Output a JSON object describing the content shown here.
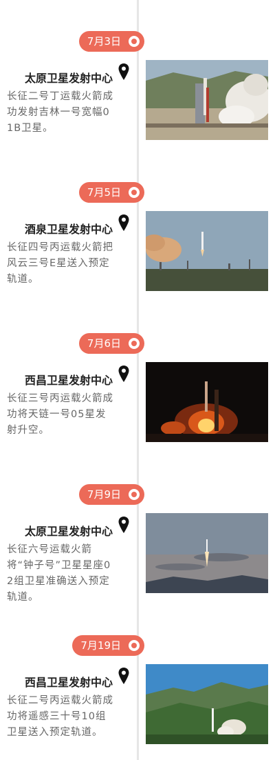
{
  "entries": [
    {
      "date": "7月3日",
      "place": "太原卫星发射中心",
      "desc": "长征二号丁运载火箭成功发射吉林一号宽幅01B卫星。",
      "photo": "launch-pad-with-smoke-photo"
    },
    {
      "date": "7月5日",
      "place": "酒泉卫星发射中心",
      "desc": "长征四号丙运载火箭把风云三号E星送入预定轨道。",
      "photo": "rocket-ascending-photo"
    },
    {
      "date": "7月6日",
      "place": "西昌卫星发射中心",
      "desc": "长征三号丙运载火箭成功将天链一号05星发射升空。",
      "photo": "night-launch-photo"
    },
    {
      "date": "7月9日",
      "place": "太原卫星发射中心",
      "desc": "长征六号运载火箭将“钟子号”卫星星座02组卫星准确送入预定轨道。",
      "photo": "dusk-launch-photo"
    },
    {
      "date": "7月19日",
      "place": "西昌卫星发射中心",
      "desc": "长征二号丙运载火箭成功将遥感三十号10组卫星送入预定轨道。",
      "photo": "mountain-launch-photo"
    }
  ],
  "colors": {
    "accent": "#ec6a58",
    "line": "#e6e6e6",
    "text": "#666666",
    "title": "#222222"
  }
}
